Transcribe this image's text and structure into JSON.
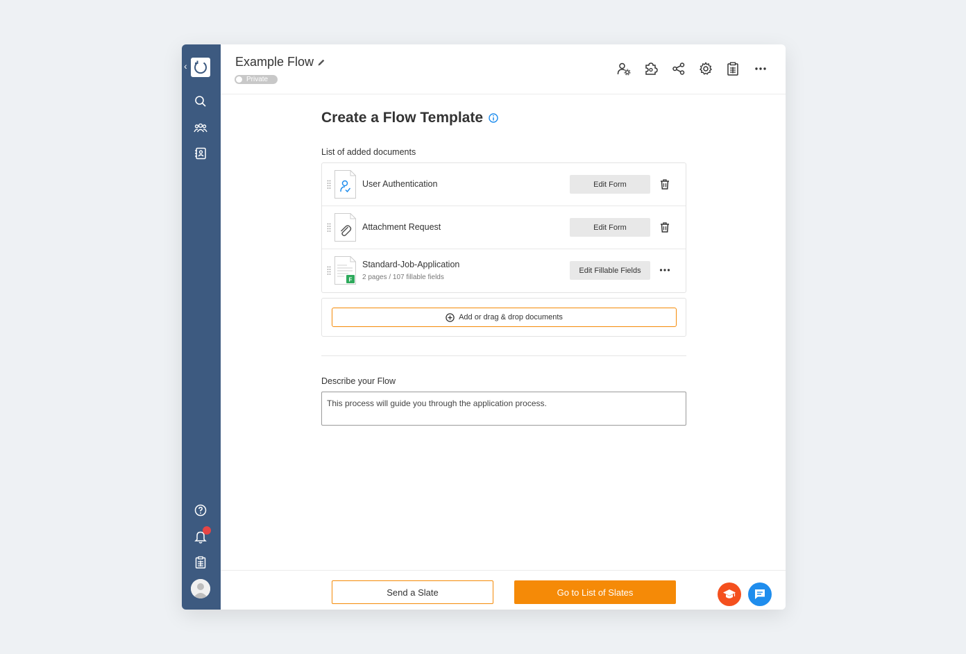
{
  "header": {
    "title": "Example Flow",
    "visibility": "Private",
    "icons": [
      "user-settings-icon",
      "puzzle-icon",
      "share-icon",
      "gear-icon",
      "clipboard-icon",
      "more-icon"
    ]
  },
  "sidebar": {
    "top_icons": [
      "search-icon",
      "team-icon",
      "contacts-icon"
    ],
    "bottom_icons": [
      "help-icon",
      "bell-icon",
      "clipboard-icon",
      "avatar"
    ]
  },
  "main": {
    "title": "Create a Flow Template",
    "documents_label": "List of added documents",
    "documents": [
      {
        "name": "User Authentication",
        "subtitle": "",
        "button": "Edit Form",
        "icon": "user-check-icon"
      },
      {
        "name": "Attachment Request",
        "subtitle": "",
        "button": "Edit Form",
        "icon": "paperclip-icon"
      },
      {
        "name": "Standard-Job-Application",
        "subtitle": "2 pages / 107 fillable fields",
        "button": "Edit Fillable Fields",
        "icon": "pdf-fillable-icon"
      }
    ],
    "add_button": "Add or drag & drop documents",
    "describe_label": "Describe your Flow",
    "description": "This process will guide you through the application process."
  },
  "footer": {
    "send_label": "Send a Slate",
    "go_label": "Go to List of Slates"
  },
  "colors": {
    "sidebar": "#3d5a80",
    "accent": "#f58a07",
    "info": "#1f8ded",
    "fab_edu": "#f4501e"
  }
}
